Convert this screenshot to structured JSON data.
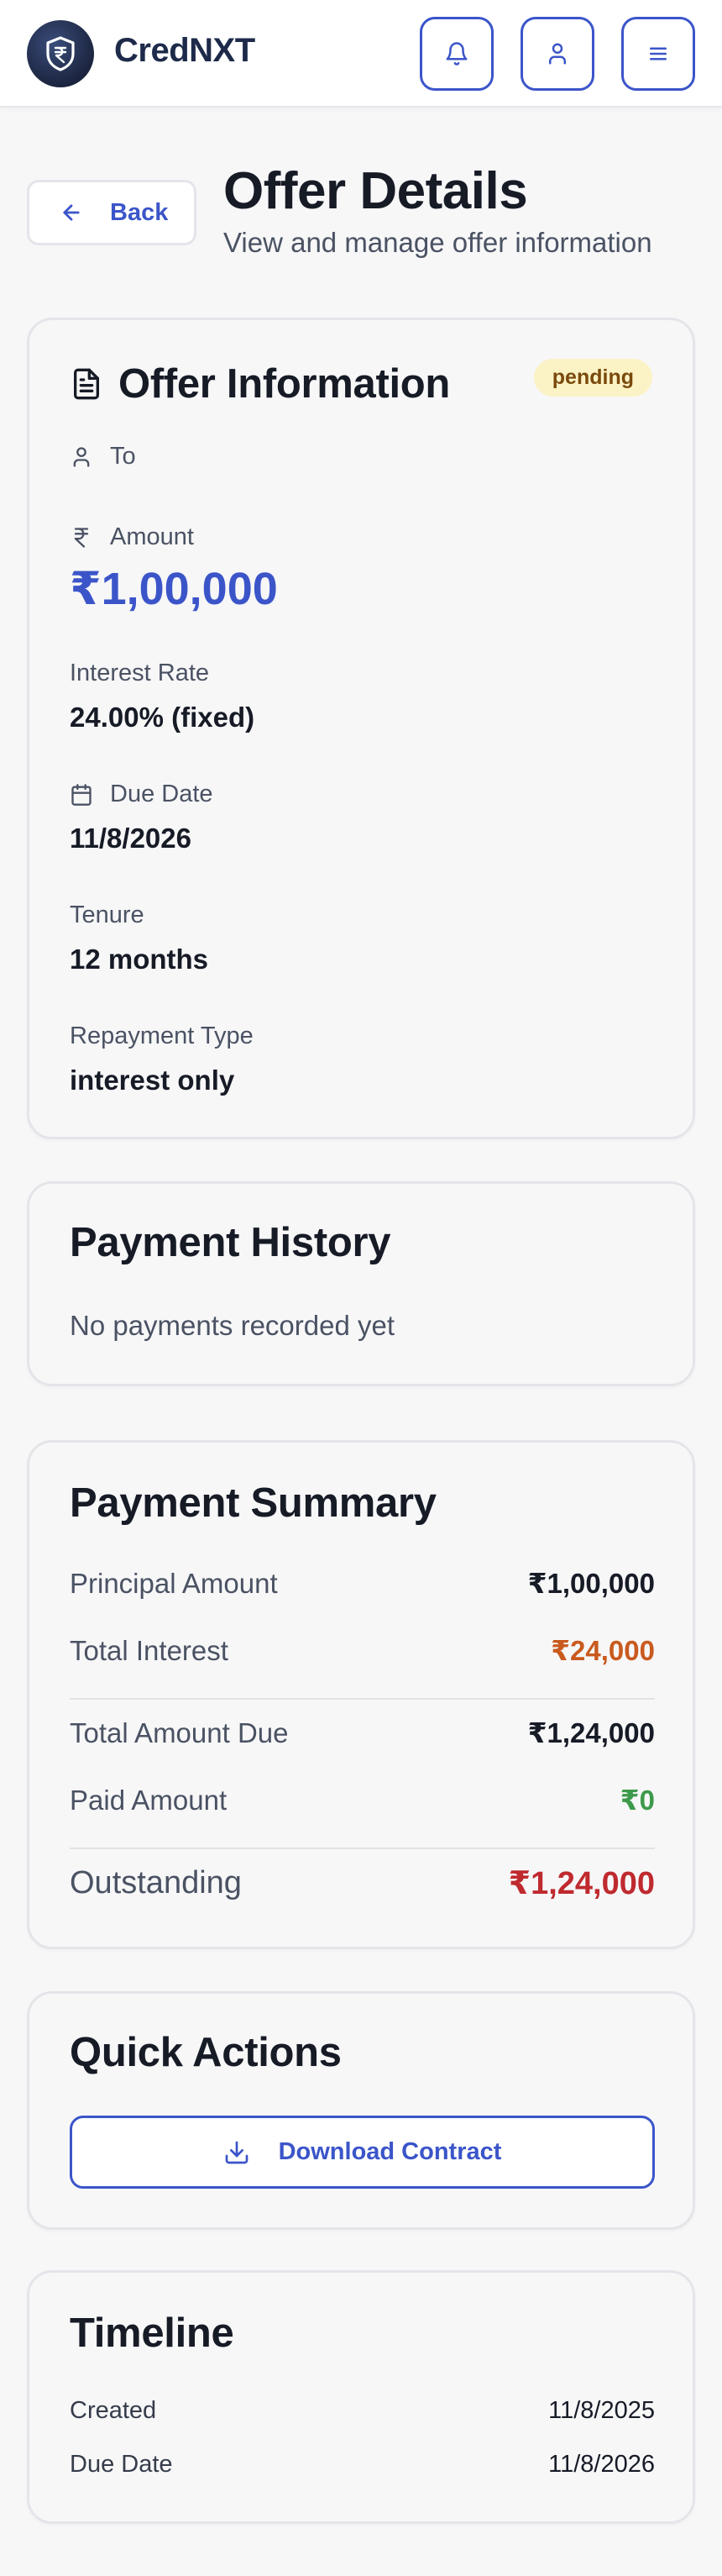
{
  "header": {
    "brand": "CredNXT",
    "notifications_icon": "bell-icon",
    "profile_icon": "user-icon",
    "menu_icon": "menu-icon",
    "logo_icon": "rupee-shield-icon"
  },
  "page": {
    "back_label": "Back",
    "title": "Offer Details",
    "subtitle": "View and manage offer information"
  },
  "offer": {
    "title": "Offer Information",
    "status": "pending",
    "to_label": "To",
    "to_value": "",
    "amount_label": "Amount",
    "amount_value": "₹1,00,000",
    "interest_label": "Interest Rate",
    "interest_value": "24.00% (fixed)",
    "due_label": "Due Date",
    "due_value": "11/8/2026",
    "tenure_label": "Tenure",
    "tenure_value": "12 months",
    "repayment_label": "Repayment Type",
    "repayment_value": "interest only"
  },
  "history": {
    "title": "Payment History",
    "empty_text": "No payments recorded yet"
  },
  "summary": {
    "title": "Payment Summary",
    "principal_label": "Principal Amount",
    "principal_value": "₹1,00,000",
    "interest_label": "Total Interest",
    "interest_value": "₹24,000",
    "total_label": "Total Amount Due",
    "total_value": "₹1,24,000",
    "paid_label": "Paid Amount",
    "paid_value": "₹0",
    "outstanding_label": "Outstanding",
    "outstanding_value": "₹1,24,000"
  },
  "actions": {
    "title": "Quick Actions",
    "download_label": "Download Contract"
  },
  "timeline": {
    "title": "Timeline",
    "created_label": "Created",
    "created_value": "11/8/2025",
    "due_label": "Due Date",
    "due_value": "11/8/2026"
  },
  "colors": {
    "accent": "#3b55c9",
    "interest": "#c95a1e",
    "paid": "#3d9a4a",
    "outstanding": "#bf2a2f",
    "badge_bg": "#fbf3c6"
  }
}
